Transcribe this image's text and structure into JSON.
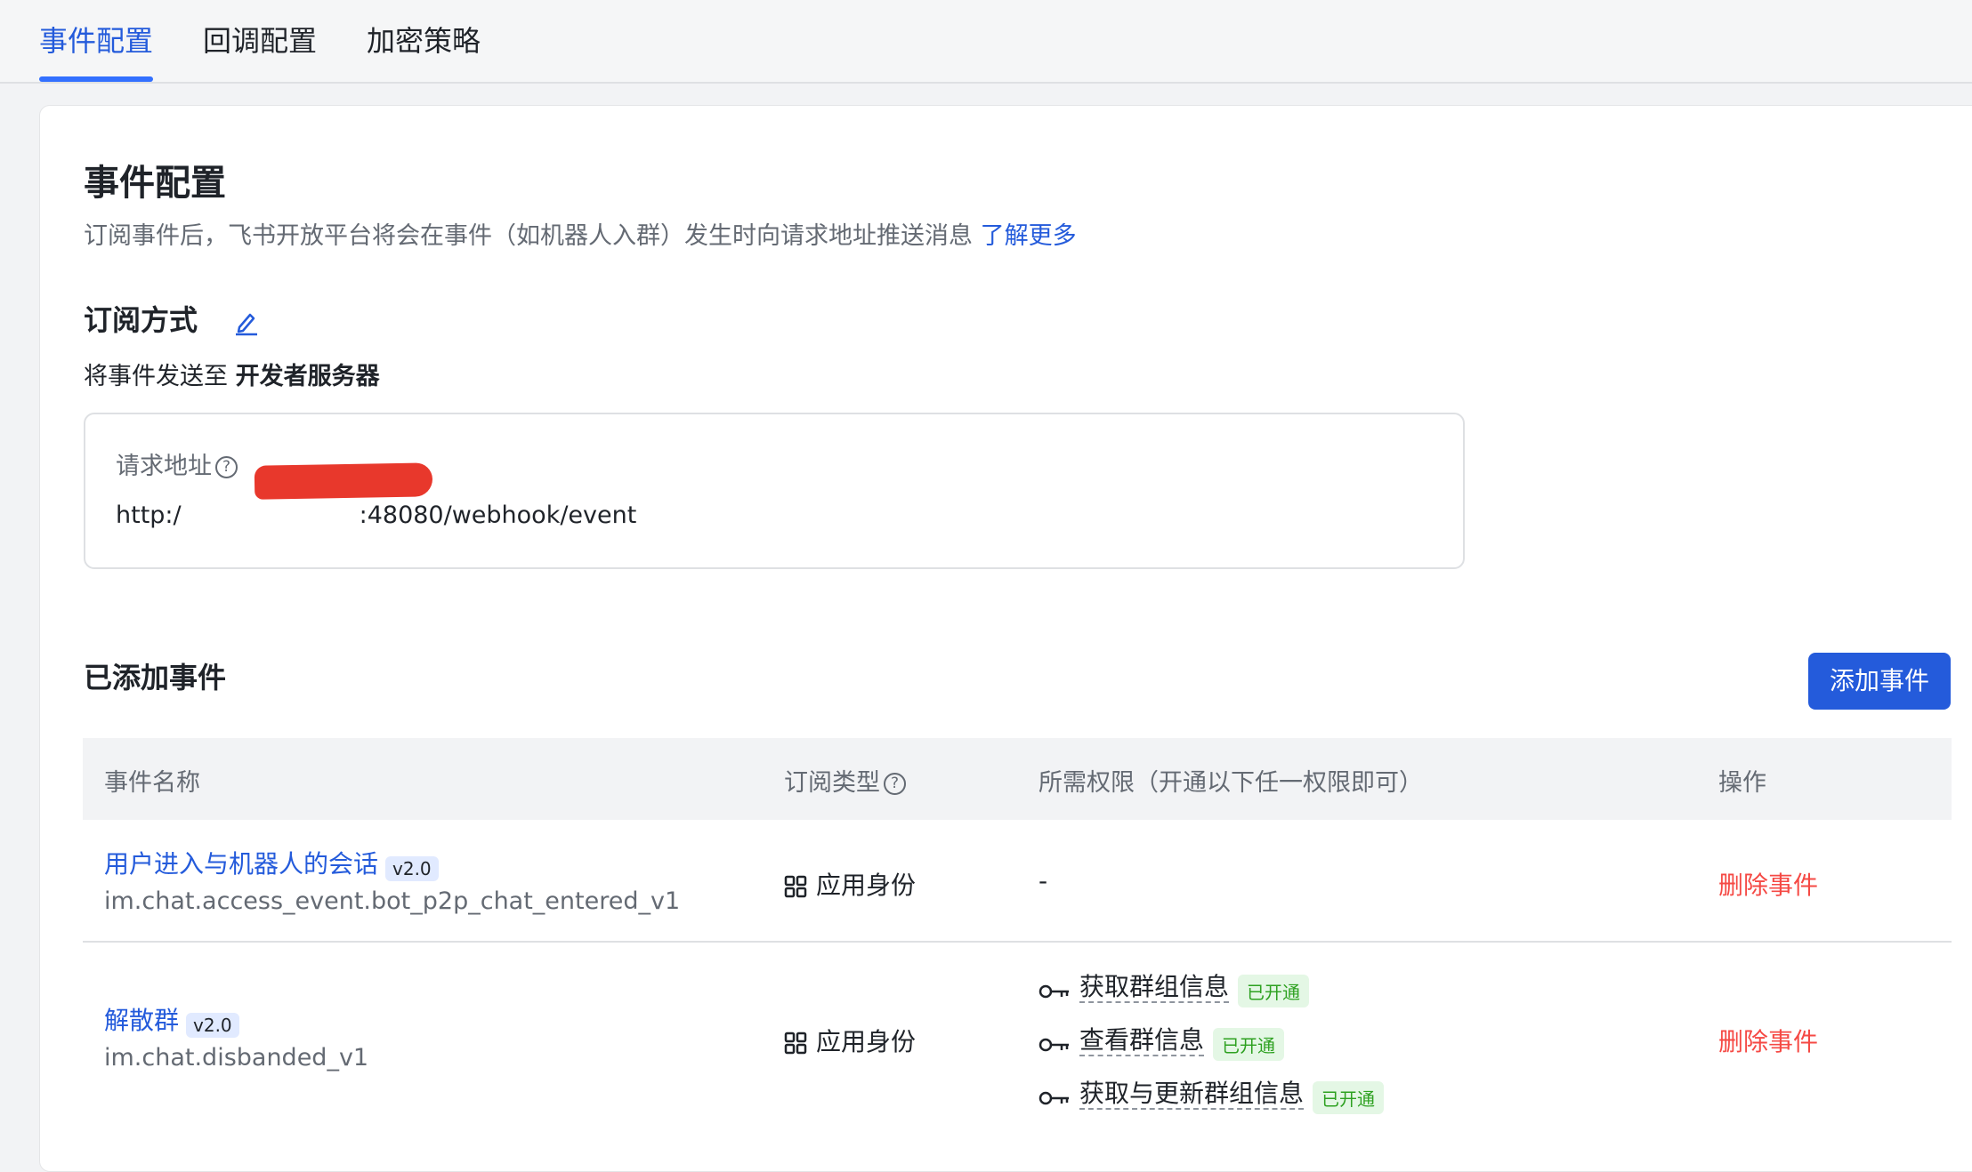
{
  "tabs": [
    {
      "label": "事件配置",
      "active": true
    },
    {
      "label": "回调配置",
      "active": false
    },
    {
      "label": "加密策略",
      "active": false
    }
  ],
  "page": {
    "title": "事件配置",
    "description": "订阅事件后，飞书开放平台将会在事件（如机器人入群）发生时向请求地址推送消息",
    "learn_more": "了解更多"
  },
  "subscription": {
    "title": "订阅方式",
    "prefix": "将事件发送至",
    "target": "开发者服务器"
  },
  "request_address": {
    "label": "请求地址",
    "url_prefix": "http:/",
    "url_suffix": ":48080/webhook/event"
  },
  "events_section": {
    "title": "已添加事件",
    "add_button": "添加事件"
  },
  "table": {
    "headers": {
      "name": "事件名称",
      "type": "订阅类型",
      "permissions": "所需权限（开通以下任一权限即可）",
      "actions": "操作"
    },
    "rows": [
      {
        "name": "用户进入与机器人的会话",
        "version": "v2.0",
        "key": "im.chat.access_event.bot_p2p_chat_entered_v1",
        "type": "应用身份",
        "permission_none": "-",
        "action": "删除事件"
      },
      {
        "name": "解散群",
        "version": "v2.0",
        "key": "im.chat.disbanded_v1",
        "type": "应用身份",
        "permissions": [
          {
            "name": "获取群组信息",
            "status": "已开通"
          },
          {
            "name": "查看群信息",
            "status": "已开通"
          },
          {
            "name": "获取与更新群组信息",
            "status": "已开通"
          }
        ],
        "action": "删除事件"
      }
    ]
  },
  "colors": {
    "accent": "#245bdb",
    "danger": "#f54a45",
    "success": "#2ea121"
  }
}
